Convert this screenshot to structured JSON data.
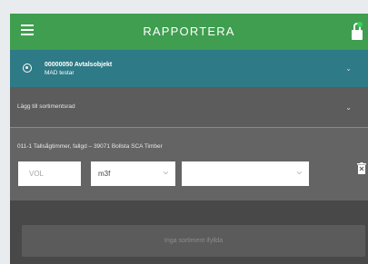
{
  "header": {
    "title": "RAPPORTERA",
    "color": "#3f9e4f"
  },
  "contract": {
    "title": "00000050 Avtalsobjekt",
    "subtitle": "MAD testar",
    "color": "#2e7a86"
  },
  "add_row": {
    "label": "Lägg till sortimentsrad"
  },
  "assortment": {
    "title": "011-1 Tallsågtimmer, fallgd – 39071 Bollsta SCA Timber",
    "volume_placeholder": "VOL",
    "unit_value": "m3f",
    "second_select_value": ""
  },
  "footer": {
    "button_label": "Inga sortiment ifyllda"
  },
  "icons": {
    "menu": "hamburger-menu-icon",
    "lock": "lock-icon",
    "radio": "radio-selected-icon",
    "chevron": "chevron-down-icon",
    "delete": "trash-icon"
  }
}
